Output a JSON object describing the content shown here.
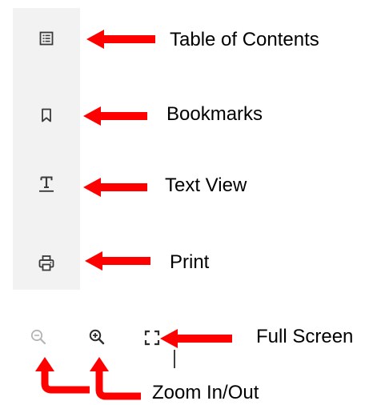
{
  "colors": {
    "sidebar_bg": "#f2f2f2",
    "icon": "#3a3a3a",
    "icon_disabled": "#b5b5b5",
    "arrow": "#ff0000",
    "label": "#000000"
  },
  "sidebar": {
    "items": [
      {
        "icon": "table-of-contents-icon",
        "label": "Table of Contents"
      },
      {
        "icon": "bookmark-icon",
        "label": "Bookmarks"
      },
      {
        "icon": "text-view-icon",
        "label": "Text View"
      },
      {
        "icon": "print-icon",
        "label": "Print"
      }
    ]
  },
  "toolbar": {
    "items": [
      {
        "icon": "zoom-out-icon",
        "state": "disabled"
      },
      {
        "icon": "zoom-in-icon",
        "state": "enabled"
      },
      {
        "icon": "full-screen-icon",
        "state": "enabled"
      }
    ],
    "zoom_label": "Zoom In/Out",
    "fullscreen_label": "Full Screen"
  }
}
